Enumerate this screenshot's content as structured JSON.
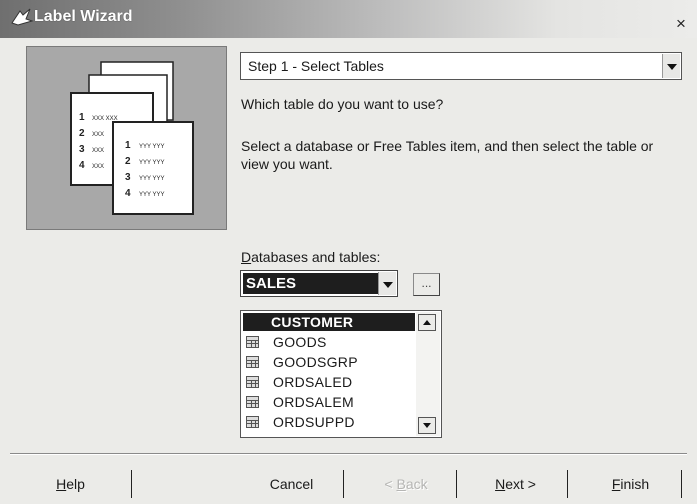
{
  "window": {
    "title": "Label Wizard",
    "close_glyph": "×",
    "title_icon": "wizard-icon"
  },
  "picture": {
    "front_rows": [
      {
        "num": "1",
        "text": "YYY YYY"
      },
      {
        "num": "2",
        "text": "YYY YYY"
      },
      {
        "num": "3",
        "text": "YYY YYY"
      },
      {
        "num": "4",
        "text": "YYY YYY"
      }
    ],
    "back_rows": [
      {
        "num": "1",
        "text": "XXX XXX"
      },
      {
        "num": "2",
        "text": "XXX"
      },
      {
        "num": "3",
        "text": "XXX"
      },
      {
        "num": "4",
        "text": "XXX"
      }
    ]
  },
  "step": {
    "selected": "Step 1 - Select Tables"
  },
  "question": "Which table do you want to use?",
  "instruction": "Select a database or Free Tables item, and then select the table or view you want.",
  "databases": {
    "label_prefix": "D",
    "label_rest": "atabases and tables:",
    "selected": "SALES",
    "browse_label": "..."
  },
  "tables": [
    {
      "name": "CUSTOMER",
      "selected": true
    },
    {
      "name": "GOODS",
      "selected": false
    },
    {
      "name": "GOODSGRP",
      "selected": false
    },
    {
      "name": "ORDSALED",
      "selected": false
    },
    {
      "name": "ORDSALEM",
      "selected": false
    },
    {
      "name": "ORDSUPPD",
      "selected": false
    }
  ],
  "buttons": {
    "help_u": "H",
    "help_rest": "elp",
    "cancel": "Cancel",
    "back_u": "B",
    "back_pre": "< ",
    "back_rest": "ack",
    "next_u": "N",
    "next_rest": "ext >",
    "finish_u": "F",
    "finish_rest": "inish"
  }
}
